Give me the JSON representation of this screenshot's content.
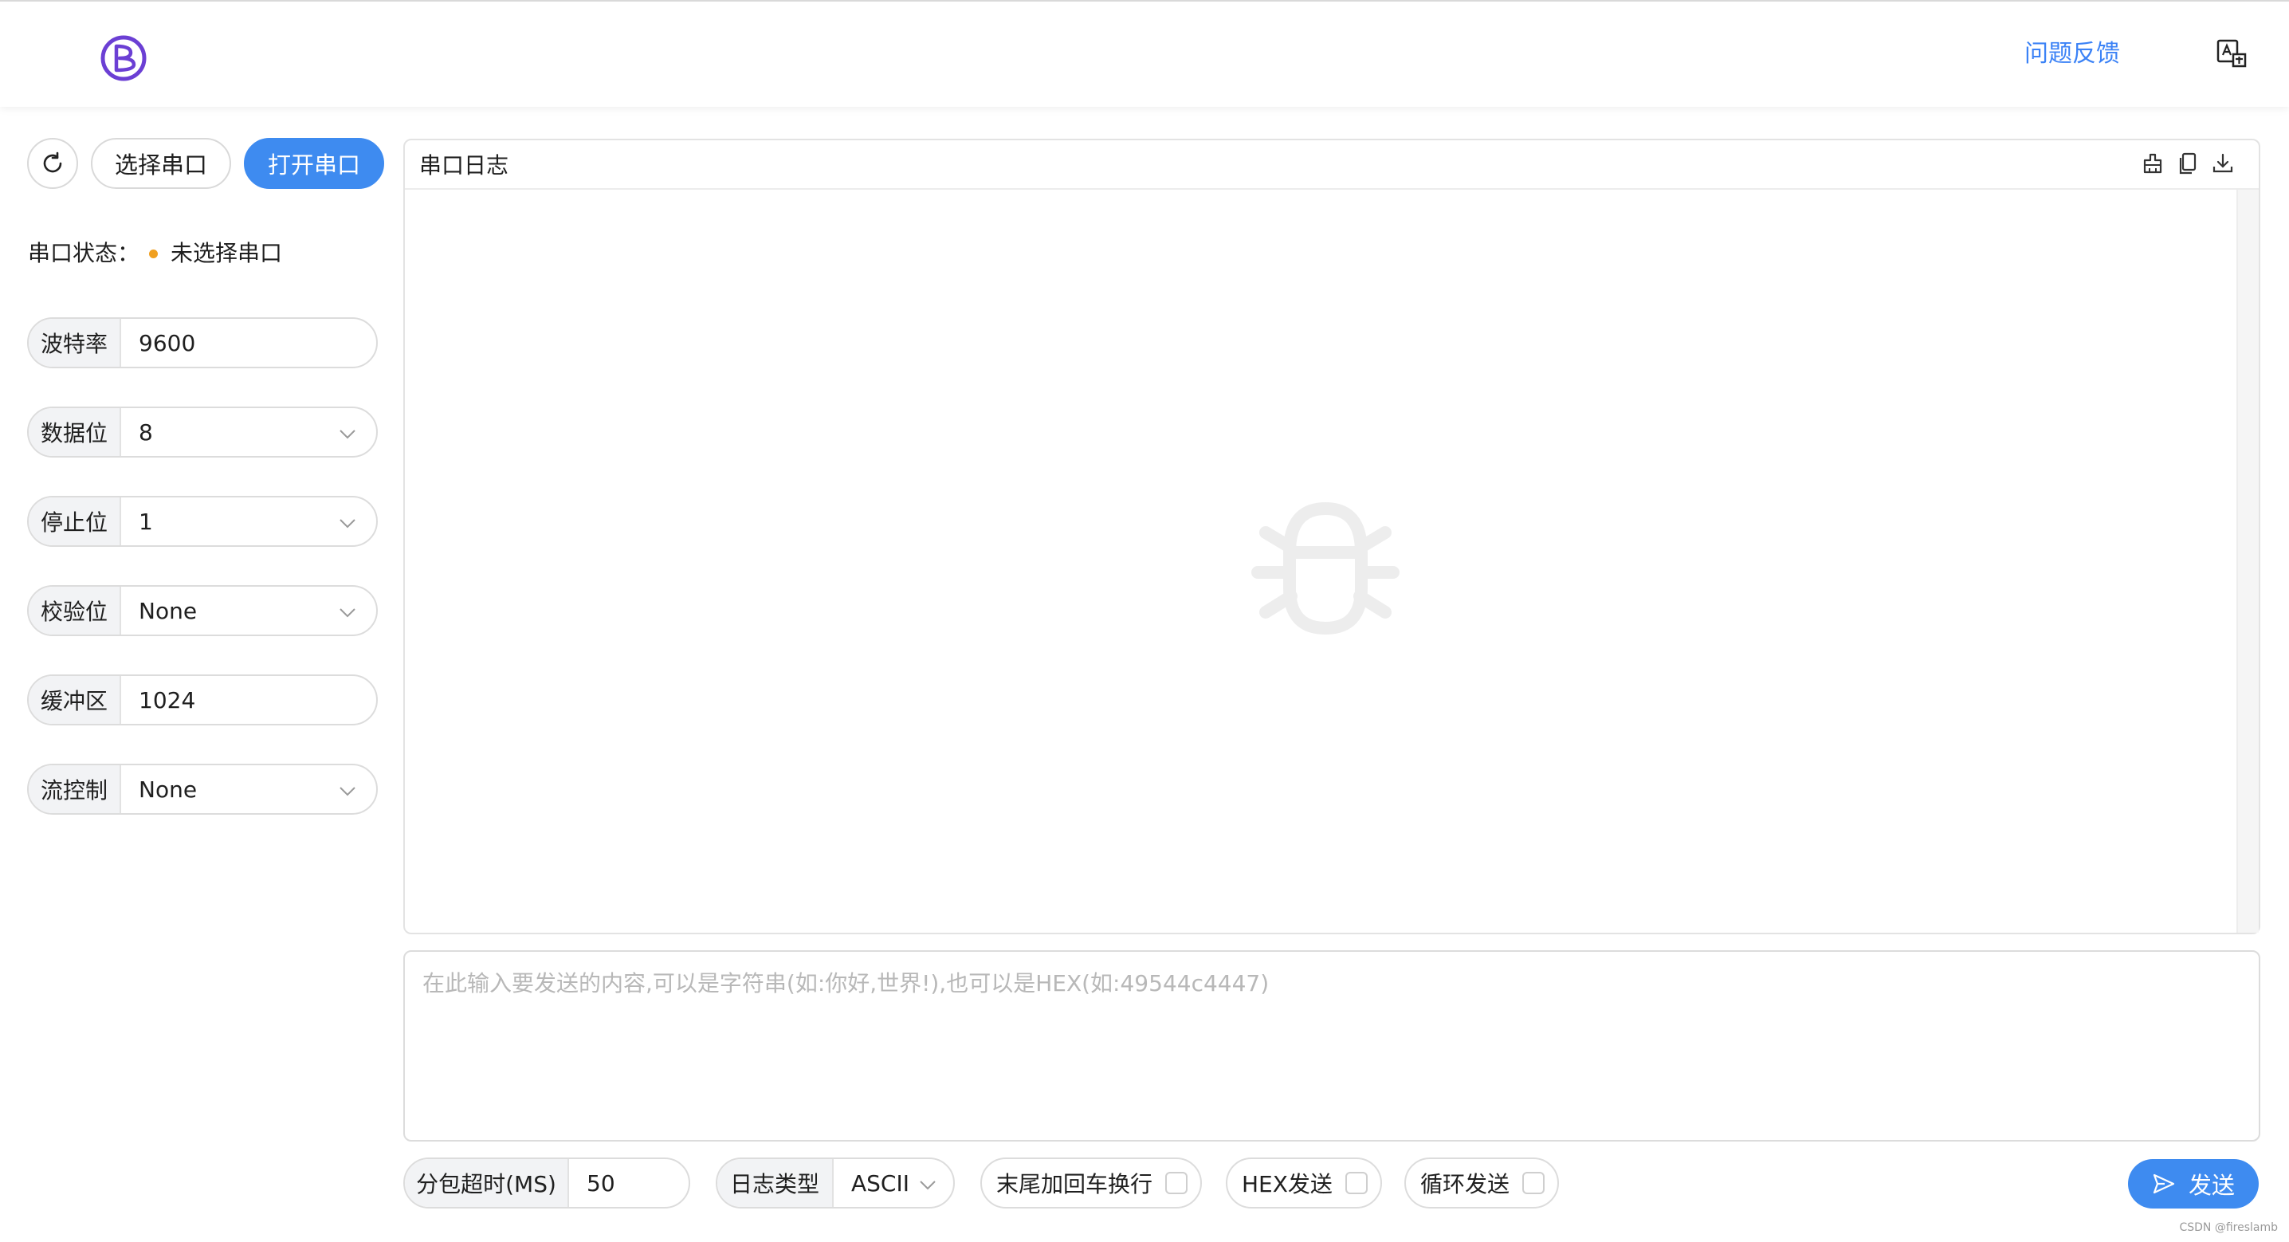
{
  "header": {
    "logo_icon": "b-logo-icon",
    "feedback_link": "问题反馈",
    "translate_icon": "translate-icon"
  },
  "toolbar": {
    "refresh_icon": "refresh-icon",
    "select_port_label": "选择串口",
    "open_port_label": "打开串口"
  },
  "status": {
    "label": "串口状态：",
    "value": "未选择串口",
    "dot_color": "#f0a020"
  },
  "settings": {
    "baud_rate": {
      "label": "波特率",
      "value": "9600"
    },
    "data_bits": {
      "label": "数据位",
      "value": "8"
    },
    "stop_bits": {
      "label": "停止位",
      "value": "1"
    },
    "parity": {
      "label": "校验位",
      "value": "None"
    },
    "buffer": {
      "label": "缓冲区",
      "value": "1024"
    },
    "flow_control": {
      "label": "流控制",
      "value": "None"
    }
  },
  "log": {
    "title": "串口日志",
    "tools": [
      "clear-icon",
      "copy-icon",
      "download-icon"
    ],
    "empty_icon": "bug-icon"
  },
  "send": {
    "placeholder": "在此输入要发送的内容,可以是字符串(如:你好,世界!),也可以是HEX(如:49544c4447)",
    "timeout_label": "分包超时(MS)",
    "timeout_value": "50",
    "log_type_label": "日志类型",
    "log_type_value": "ASCII",
    "append_crlf_label": "末尾加回车换行",
    "hex_send_label": "HEX发送",
    "loop_send_label": "循环发送",
    "send_button": "发送"
  },
  "colors": {
    "accent": "#3e8bf0",
    "logo": "#6b3fd4",
    "status_dot": "#f0a020"
  },
  "watermark": "CSDN @fireslamb"
}
